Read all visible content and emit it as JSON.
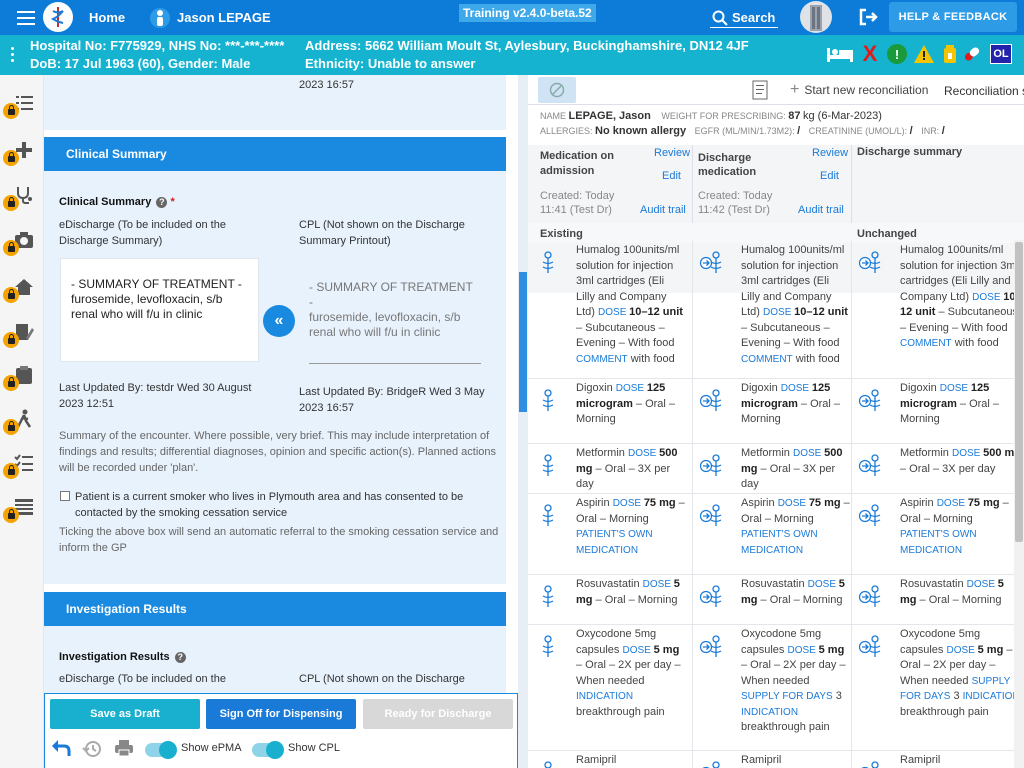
{
  "topbar": {
    "home_label": "Home",
    "user_name": "Jason LEPAGE",
    "training_label": "Training v2.4.0-beta.52",
    "search_label": "Search",
    "help_label": "HELP & FEEDBACK"
  },
  "banner": {
    "hospital_no": "Hospital No: F775929, NHS No: ***-***-****",
    "dob": "DoB: 17 Jul 1963 (60), Gender: Male",
    "address": "Address: 5662 William Moult St, Aylesbury, Buckinghamshire, DN12 4JF",
    "ethnicity": "Ethnicity: Unable to answer",
    "alert_red": "X",
    "alert_green": "!",
    "alert_warn": "!",
    "ol_badge": "OL"
  },
  "middle": {
    "top_date_fragment": "2023 16:57",
    "clinical_summary": {
      "section_title": "Clinical Summary",
      "field_label": "Clinical Summary",
      "required_mark": "*",
      "edischarge_label": "eDischarge (To be included on the Discharge Summary)",
      "cpl_label": "CPL (Not shown on the Discharge Summary Printout)",
      "edischarge_value": "- SUMMARY OF TREATMENT - furosemide, levofloxacin, s/b renal who will f/u in clinic",
      "cpl_value_line1": "- SUMMARY OF TREATMENT",
      "cpl_value_line2": "-",
      "cpl_value_line3": "furosemide, levofloxacin, s/b renal who will f/u in clinic",
      "copy_button": "«",
      "edischarge_updated": "Last Updated By: testdr Wed 30 August 2023 12:51",
      "cpl_updated": "Last Updated By: BridgeR Wed 3 May 2023 16:57",
      "help_text": "Summary of the encounter. Where possible, very brief. This may include interpretation of findings and results; differential diagnoses, opinion and specific action(s). Planned actions will be recorded under 'plan'.",
      "smoker_checkbox_label": "Patient is a current smoker who lives in Plymouth area and has consented to be contacted by the smoking cessation service",
      "smoker_note": "Ticking the above box will send an automatic referral to the smoking cessation service and inform the GP"
    },
    "investigation_results": {
      "section_title": "Investigation Results",
      "field_label": "Investigation Results",
      "edischarge_label": "eDischarge (To be included on the",
      "cpl_label": "CPL (Not shown on the Discharge"
    }
  },
  "actions": {
    "save_draft": "Save as Draft",
    "sign_off": "Sign Off for Dispensing",
    "ready_discharge": "Ready for Discharge",
    "show_epma": "Show ePMA",
    "show_cpl": "Show CPL"
  },
  "right": {
    "start_reconciliation": "Start new reconciliation",
    "reconciliation_status": "Reconciliation st",
    "patient": {
      "name_label": "NAME",
      "name_value": "LEPAGE, Jason",
      "weight_label": "WEIGHT FOR PRESCRIBING:",
      "weight_value": "87",
      "weight_unit": "kg (6-Mar-2023)",
      "allergies_label": "ALLERGIES:",
      "allergies_value": "No known allergy",
      "egfr_label": "EGFR (ML/MIN/1.73M2):",
      "egfr_value": "/",
      "creat_label": "CREATININE (UMOL/L):",
      "creat_value": "/",
      "inr_label": "INR:",
      "inr_value": "/"
    },
    "columns": {
      "admission": {
        "title_l1": "Medication on",
        "title_l2": "admission",
        "review": "Review",
        "edit": "Edit",
        "created_l1": "Created: Today",
        "created_l2": "11:41 (Test Dr)",
        "audit": "Audit trail",
        "sub": "Existing"
      },
      "discharge": {
        "title_l1": "Discharge",
        "title_l2": "medication",
        "review": "Review",
        "edit": "Edit",
        "created_l1": "Created: Today",
        "created_l2": "11:42 (Test Dr)",
        "audit": "Audit trail"
      },
      "summary": {
        "title": "Discharge summary",
        "sub": "Unchanged"
      }
    },
    "meds": [
      {
        "name": "Humalog 100units/ml solution for injection 3ml cartridges (Eli Lilly and Company Ltd)",
        "dose_label": "DOSE",
        "dose": "10–12 unit",
        "route": " – Subcutaneous – Evening – With food",
        "extra_label": "COMMENT",
        "extra": " with food"
      },
      {
        "name": "Digoxin",
        "dose_label": "DOSE",
        "dose": "125 microgram",
        "route": " – Oral – Morning"
      },
      {
        "name": "Metformin",
        "dose_label": "DOSE",
        "dose": "500 mg",
        "route": " – Oral – 3X per day"
      },
      {
        "name": "Aspirin",
        "dose_label": "DOSE",
        "dose": "75 mg",
        "route": " – Oral – Morning",
        "extra_label": "PATIENT'S OWN MEDICATION"
      },
      {
        "name": "Rosuvastatin",
        "dose_label": "DOSE",
        "dose": "5 mg",
        "route": " – Oral – Morning"
      },
      {
        "name": "Oxycodone 5mg capsules",
        "dose_label": "DOSE",
        "dose": "5 mg",
        "route": " – Oral – 2X per day – When needed",
        "extra_label": "INDICATION",
        "extra": " breakthrough pain",
        "alt_extra_label": "SUPPLY FOR DAYS",
        "alt_extra": " 3"
      },
      {
        "name": "Ramipril"
      }
    ]
  }
}
